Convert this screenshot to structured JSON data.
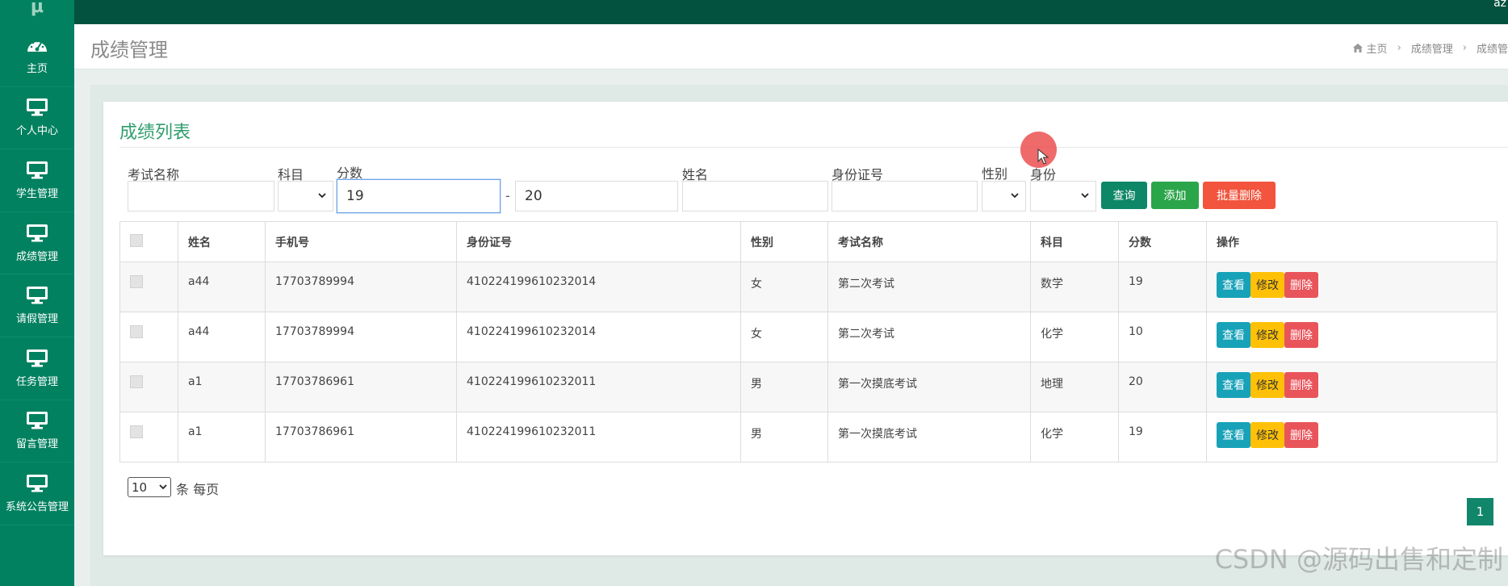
{
  "topbar": {
    "user": "az"
  },
  "sidebar": {
    "logo": "μ",
    "items": [
      {
        "label": "主页",
        "icon": "dashboard-icon"
      },
      {
        "label": "个人中心",
        "icon": "monitor-icon"
      },
      {
        "label": "学生管理",
        "icon": "monitor-icon"
      },
      {
        "label": "成绩管理",
        "icon": "monitor-icon"
      },
      {
        "label": "请假管理",
        "icon": "monitor-icon"
      },
      {
        "label": "任务管理",
        "icon": "monitor-icon"
      },
      {
        "label": "留言管理",
        "icon": "monitor-icon"
      },
      {
        "label": "系统公告管理",
        "icon": "monitor-icon"
      }
    ]
  },
  "header": {
    "title": "成绩管理",
    "breadcrumb": [
      "主页",
      "成绩管理",
      "成绩管"
    ]
  },
  "panel": {
    "title": "成绩列表"
  },
  "filters": {
    "exam_name_label": "考试名称",
    "exam_name_value": "",
    "subject_label": "科目",
    "score_label": "分数",
    "score_min": "19",
    "score_dash": "-",
    "score_max": "20",
    "name_label": "姓名",
    "name_value": "",
    "id_label": "身份证号",
    "id_value": "",
    "gender_label": "性别",
    "role_label": "身份"
  },
  "buttons": {
    "query": "查询",
    "add": "添加",
    "batch_delete": "批量删除"
  },
  "colors": {
    "sidebar": "#028160",
    "topbar": "#03513f",
    "query": "#0e8766",
    "add": "#2aa549",
    "batch_delete": "#f2543d",
    "view": "#17a2b8",
    "edit": "#ffc107",
    "delete": "#e9545b",
    "title": "#2f9e6e"
  },
  "table": {
    "headers": [
      "姓名",
      "手机号",
      "身份证号",
      "性别",
      "考试名称",
      "科目",
      "分数",
      "操作"
    ],
    "rows": [
      {
        "name": "a44",
        "phone": "17703789994",
        "id_no": "410224199610232014",
        "gender": "女",
        "exam": "第二次考试",
        "subject": "数学",
        "score": "19"
      },
      {
        "name": "a44",
        "phone": "17703789994",
        "id_no": "410224199610232014",
        "gender": "女",
        "exam": "第二次考试",
        "subject": "化学",
        "score": "10"
      },
      {
        "name": "a1",
        "phone": "17703786961",
        "id_no": "410224199610232011",
        "gender": "男",
        "exam": "第一次摸底考试",
        "subject": "地理",
        "score": "20"
      },
      {
        "name": "a1",
        "phone": "17703786961",
        "id_no": "410224199610232011",
        "gender": "男",
        "exam": "第一次摸底考试",
        "subject": "化学",
        "score": "19"
      }
    ],
    "actions": {
      "view": "查看",
      "edit": "修改",
      "delete": "删除"
    }
  },
  "pager": {
    "page_size": "10",
    "per_page_text": "条 每页",
    "current_page": "1"
  },
  "watermark": "CSDN @源码出售和定制"
}
